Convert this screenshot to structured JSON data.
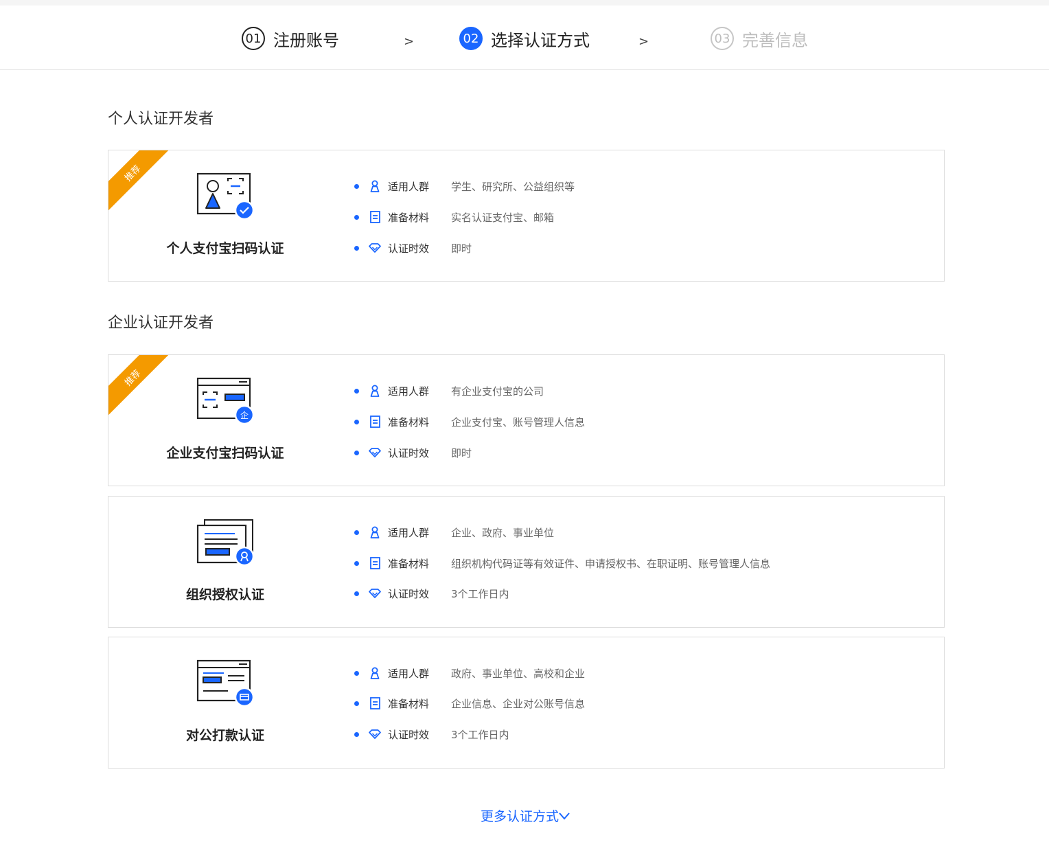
{
  "steps": [
    {
      "num": "01",
      "label": "注册账号"
    },
    {
      "num": "02",
      "label": "选择认证方式"
    },
    {
      "num": "03",
      "label": "完善信息"
    }
  ],
  "step_arrow": ">",
  "sections": {
    "personal": "个人认证开发者",
    "enterprise": "企业认证开发者"
  },
  "ribbon_text": "推荐",
  "row_labels": {
    "audience": "适用人群",
    "materials": "准备材料",
    "time": "认证时效"
  },
  "cards": [
    {
      "title": "个人支付宝扫码认证",
      "audience": "学生、研究所、公益组织等",
      "materials": "实名认证支付宝、邮箱",
      "time": "即时"
    },
    {
      "title": "企业支付宝扫码认证",
      "audience": "有企业支付宝的公司",
      "materials": "企业支付宝、账号管理人信息",
      "time": "即时",
      "badge_char": "企"
    },
    {
      "title": "组织授权认证",
      "audience": "企业、政府、事业单位",
      "materials": "组织机构代码证等有效证件、申请授权书、在职证明、账号管理人信息",
      "time": "3个工作日内"
    },
    {
      "title": "对公打款认证",
      "audience": "政府、事业单位、高校和企业",
      "materials": "企业信息、企业对公账号信息",
      "time": "3个工作日内"
    }
  ],
  "more_link": "更多认证方式",
  "colors": {
    "accent": "#1a66ff",
    "ribbon": "#f49a00"
  }
}
